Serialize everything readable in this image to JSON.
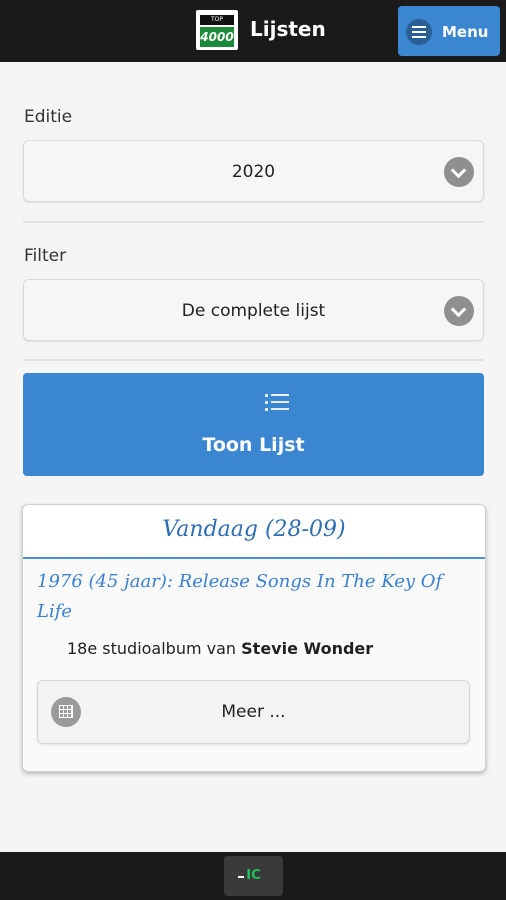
{
  "header": {
    "logo_top_text": "TOP",
    "logo_number": "4000",
    "title": "Lijsten",
    "menu_label": "Menu"
  },
  "edition": {
    "label": "Editie",
    "value": "2020"
  },
  "filter": {
    "label": "Filter",
    "value": "De complete lijst"
  },
  "show_list_button": {
    "label": "Toon Lijst"
  },
  "today_card": {
    "title": "Vandaag (28-09)",
    "event_link": "1976 (45 jaar): Release Songs In The Key Of Life",
    "desc_prefix": "18e studioalbum van",
    "artist": "Stevie Wonder",
    "more_label": "Meer ..."
  },
  "footer": {
    "logo_text": "IC"
  },
  "colors": {
    "header_bg": "#1a1a1a",
    "accent_blue": "#3a86d0",
    "link_blue": "#3a80cf",
    "footer_logo_green": "#21c35a"
  },
  "icons": {
    "menu": "hamburger-icon",
    "chevron": "chevron-down-icon",
    "list": "list-icon",
    "calendar": "calendar-icon"
  }
}
